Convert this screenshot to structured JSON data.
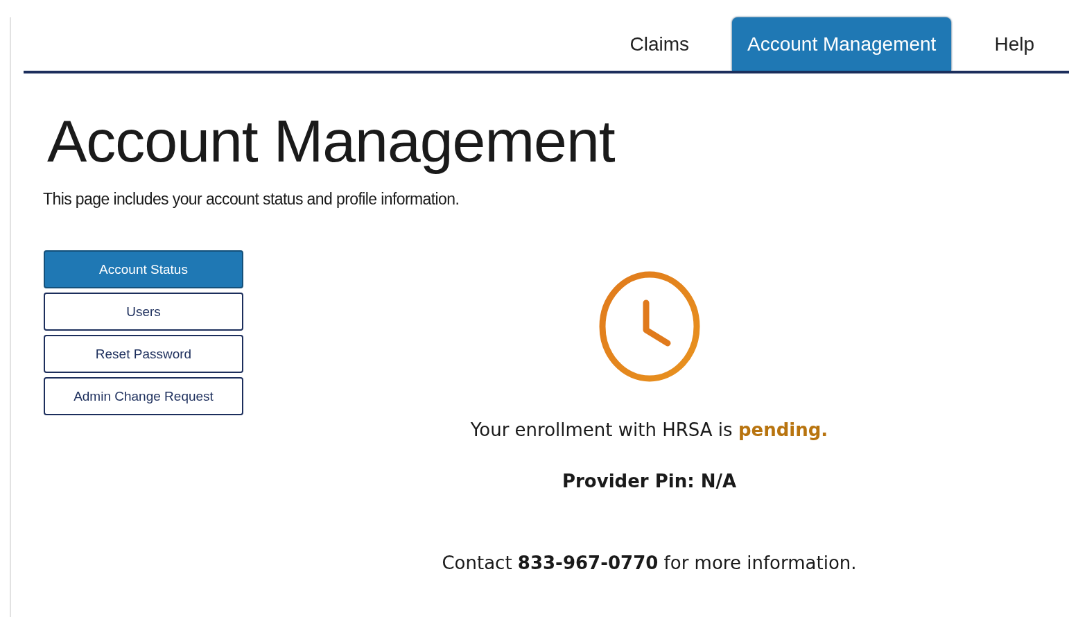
{
  "tabs": [
    {
      "label": "Claims",
      "selected": false
    },
    {
      "label": "Account Management",
      "selected": true
    },
    {
      "label": "Help",
      "selected": false
    }
  ],
  "page": {
    "title": "Account Management",
    "subtitle": "This page includes your account status and profile information."
  },
  "sidebar": {
    "items": [
      {
        "label": "Account Status",
        "selected": true
      },
      {
        "label": "Users",
        "selected": false
      },
      {
        "label": "Reset Password",
        "selected": false
      },
      {
        "label": "Admin Change Request",
        "selected": false
      }
    ]
  },
  "status": {
    "message": "Your enrollment with HRSA is **pending.**",
    "provider_pin": "Provider Pin: N/A",
    "contact": "Contact **833-967-0770** for more information."
  }
}
